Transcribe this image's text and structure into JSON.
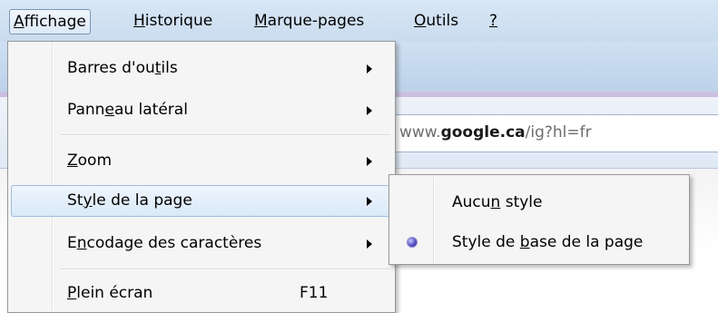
{
  "menubar": {
    "items": [
      {
        "label_first": "A",
        "label_rest": "ffichage",
        "active": true
      },
      {
        "label_first": "H",
        "label_rest": "istorique"
      },
      {
        "label_first": "M",
        "label_rest": "arque-pages"
      },
      {
        "label_first": "O",
        "label_rest": "utils"
      },
      {
        "label_first": "?",
        "label_rest": ""
      }
    ]
  },
  "address": {
    "url_prefix": "www.",
    "url_domain": "google.ca",
    "url_path": "/ig?hl=fr"
  },
  "menu": {
    "items": [
      {
        "pre": "Barres d'ou",
        "key": "t",
        "post": "ils",
        "submenu": true
      },
      {
        "pre": "Pann",
        "key": "e",
        "post": "au latéral",
        "submenu": true
      },
      {
        "pre": "",
        "key": "Z",
        "post": "oom",
        "submenu": true
      },
      {
        "pre": "St",
        "key": "y",
        "post": "le de la page",
        "submenu": true,
        "highlighted": true
      },
      {
        "pre": "E",
        "key": "n",
        "post": "codage des caractères",
        "submenu": true
      },
      {
        "pre": "",
        "key": "P",
        "post": "lein écran",
        "shortcut": "F11"
      }
    ]
  },
  "submenu": {
    "items": [
      {
        "pre": "Aucu",
        "key": "n",
        "post": " style",
        "selected": false
      },
      {
        "pre": "Style de ",
        "key": "b",
        "post": "ase de la page",
        "selected": true
      }
    ]
  },
  "colors": {
    "menubar_bg": "#d0e1f2",
    "highlight_border": "#9ebde0",
    "radio": "#4a45b8"
  }
}
